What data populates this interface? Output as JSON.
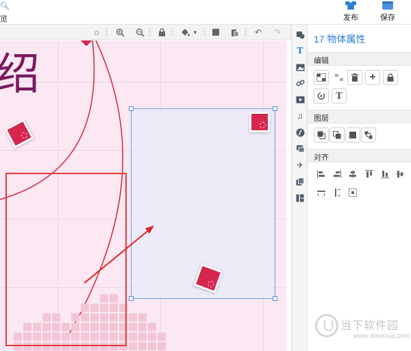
{
  "header": {
    "left_label": "览",
    "publish_label": "发布",
    "save_label": "保存"
  },
  "canvas_toolbar": {
    "icons": [
      "home-icon",
      "zoom-in-icon",
      "zoom-out-icon",
      "lock-icon",
      "fill-color-icon",
      "chevron-down-icon",
      "bring-front-icon",
      "paste-icon",
      "undo-icon",
      "redo-icon"
    ]
  },
  "canvas": {
    "title_text": "绍",
    "colors": {
      "background": "#fbe8f2",
      "title": "#7b1a60",
      "accent": "#d5264e",
      "frame": "#e33b3b",
      "selection": "#6ea0dd"
    }
  },
  "side_tabs": {
    "text_tab_label": "T",
    "icons": [
      "shapes-icon",
      "text-icon",
      "image-icon",
      "link-icon",
      "video-icon",
      "music-icon",
      "flash-icon",
      "shapes-3d-icon",
      "airplane-icon",
      "layers-icon",
      "layout-icon"
    ]
  },
  "properties_panel": {
    "title": "17 物体属性",
    "edit_section": {
      "label": "编辑",
      "text_button_label": "T"
    },
    "layer_section": {
      "label": "图层"
    },
    "align_section": {
      "label": "对齐"
    }
  },
  "watermark": {
    "brand": "当下软件园",
    "url": "www.downxia.com"
  }
}
